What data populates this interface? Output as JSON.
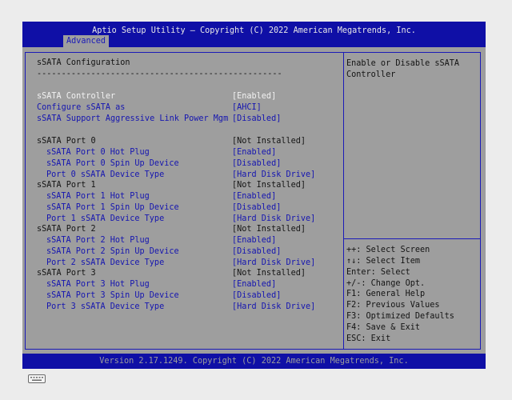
{
  "title": "Aptio Setup Utility – Copyright (C) 2022 American Megatrends, Inc.",
  "tab": "Advanced",
  "section_title": "sSATA Configuration",
  "section_rule": "--------------------------------------------------",
  "settings": [
    {
      "label": "sSATA Controller",
      "value": "[Enabled]"
    },
    {
      "label": "Configure sSATA as",
      "value": "[AHCI]"
    },
    {
      "label": "sSATA Support Aggressive Link Power Mgm",
      "value": "[Disabled]"
    }
  ],
  "ports": [
    {
      "label": "sSATA Port 0",
      "value": "[Not Installed]",
      "options": [
        {
          "label": "sSATA Port 0 Hot Plug",
          "value": "[Enabled]"
        },
        {
          "label": "sSATA Port 0 Spin Up Device",
          "value": "[Disabled]"
        },
        {
          "label": "Port 0 sSATA Device Type",
          "value": "[Hard Disk Drive]"
        }
      ]
    },
    {
      "label": "sSATA Port 1",
      "value": "[Not Installed]",
      "options": [
        {
          "label": "sSATA Port 1 Hot Plug",
          "value": "[Enabled]"
        },
        {
          "label": "sSATA Port 1 Spin Up Device",
          "value": "[Disabled]"
        },
        {
          "label": "Port 1 sSATA Device Type",
          "value": "[Hard Disk Drive]"
        }
      ]
    },
    {
      "label": "sSATA Port 2",
      "value": "[Not Installed]",
      "options": [
        {
          "label": "sSATA Port 2 Hot Plug",
          "value": "[Enabled]"
        },
        {
          "label": "sSATA Port 2 Spin Up Device",
          "value": "[Disabled]"
        },
        {
          "label": "Port 2 sSATA Device Type",
          "value": "[Hard Disk Drive]"
        }
      ]
    },
    {
      "label": "sSATA Port 3",
      "value": "[Not Installed]",
      "options": [
        {
          "label": "sSATA Port 3 Hot Plug",
          "value": "[Enabled]"
        },
        {
          "label": "sSATA Port 3 Spin Up Device",
          "value": "[Disabled]"
        },
        {
          "label": "Port 3 sSATA Device Type",
          "value": "[Hard Disk Drive]"
        }
      ]
    }
  ],
  "help": [
    "Enable or Disable sSATA",
    "Controller"
  ],
  "keys": [
    "++: Select Screen",
    "↑↓: Select Item",
    "Enter: Select",
    "+/-: Change Opt.",
    "F1: General Help",
    "F2: Previous Values",
    "F3: Optimized Defaults",
    "F4: Save & Exit",
    "ESC: Exit"
  ],
  "status": "Version 2.17.1249. Copyright (C) 2022 American Megatrends, Inc.",
  "icons": {
    "keyboard": "keyboard-icon"
  },
  "colors": {
    "title_bar": "#0f0fa6",
    "panel": "#9e9e9e",
    "selected_text": "#f2f2f2",
    "option_text": "#1515b0",
    "static_text": "#141414"
  }
}
